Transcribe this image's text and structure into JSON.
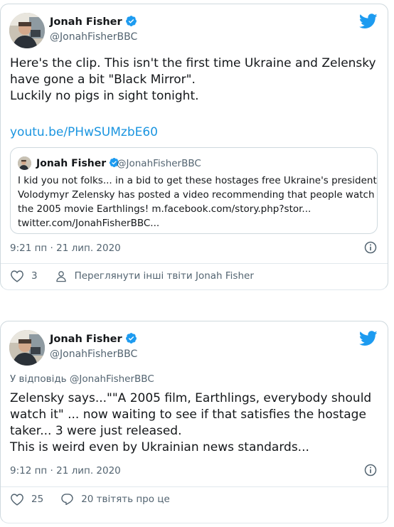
{
  "tweet1": {
    "author_name": "Jonah Fisher",
    "author_handle": "@JonahFisherBBC",
    "text_lines": [
      "Here's the clip. This isn't the first time Ukraine and Zelensky",
      "have gone a bit \"Black Mirror\".",
      "Luckily no pigs in sight tonight."
    ],
    "link": "youtu.be/PHwSUMzbE60",
    "quote": {
      "author_name": "Jonah Fisher",
      "author_handle": "@JonahFisherBBC",
      "text_lines": [
        "I kid you not folks... in a bid to get these hostages free Ukraine's president",
        "Volodymyr Zelensky has posted a video recommending that people watch",
        "the 2005 movie Earthlings! m.facebook.com/story.php?stor...",
        "twitter.com/JonahFisherBBC..."
      ]
    },
    "timestamp": "9:21 пп · 21 лип. 2020",
    "likes": "3",
    "see_more": "Переглянути інші твіти Jonah Fisher"
  },
  "tweet2": {
    "author_name": "Jonah Fisher",
    "author_handle": "@JonahFisherBBC",
    "reply_to": "У відповідь @JonahFisherBBC",
    "text_lines": [
      "Zelensky says...\"\"A 2005 film, Earthlings, everybody should",
      "watch it\" ... now waiting to see if that satisfies the hostage",
      "taker... 3 were just released.",
      "This is weird even by Ukrainian news standards..."
    ],
    "timestamp": "9:12 пп · 21 лип. 2020",
    "likes": "25",
    "replies_text": "20 твітять про це"
  },
  "colors": {
    "link": "#1b95e0",
    "verified": "#1d9bf0",
    "secondary_text": "#536471",
    "border": "#cfd9de"
  },
  "icons": [
    "verified-badge-icon",
    "twitter-bird-icon",
    "info-icon",
    "heart-icon",
    "person-icon",
    "reply-bubble-icon"
  ]
}
